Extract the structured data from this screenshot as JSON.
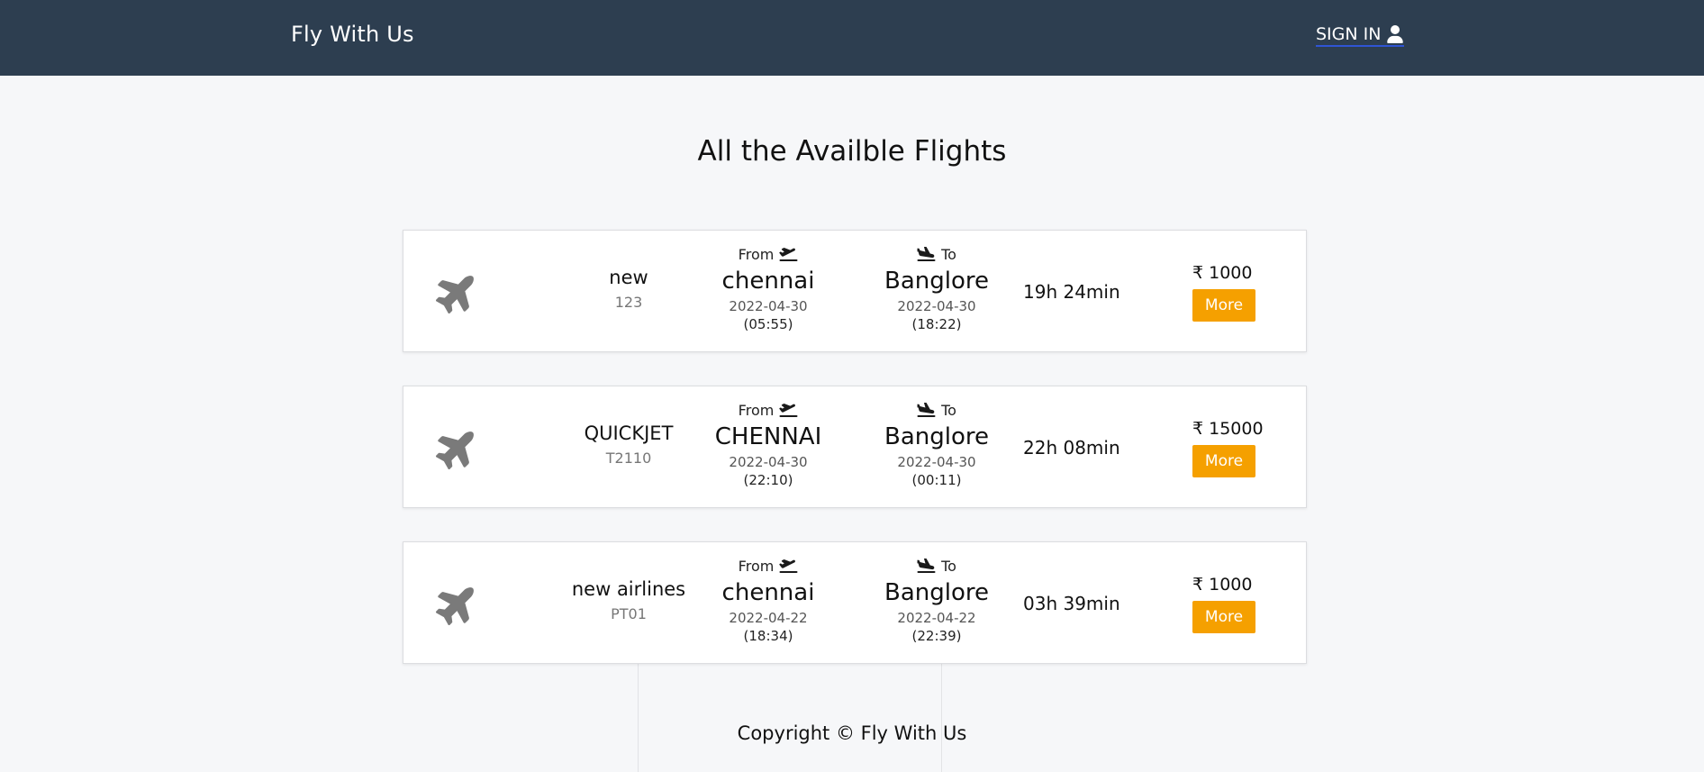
{
  "header": {
    "brand": "Fly With Us",
    "signin_label": "SIGN IN",
    "signin_icon": "user-icon",
    "background": "#2d3e50"
  },
  "main": {
    "title": "All the Availble Flights",
    "flights": [
      {
        "airline": "new",
        "code": "123",
        "from_label": "From",
        "from_city": "chennai",
        "from_date": "2022-04-30",
        "from_time": "(05:55)",
        "to_label": "To",
        "to_city": "Banglore",
        "to_date": "2022-04-30",
        "to_time": "(18:22)",
        "duration": "19h 24min",
        "price": "₹ 1000",
        "more_label": "More"
      },
      {
        "airline": "QUICKJET",
        "code": "T2110",
        "from_label": "From",
        "from_city": "CHENNAI",
        "from_date": "2022-04-30",
        "from_time": "(22:10)",
        "to_label": "To",
        "to_city": "Banglore",
        "to_date": "2022-04-30",
        "to_time": "(00:11)",
        "duration": "22h 08min",
        "price": "₹ 15000",
        "more_label": "More"
      },
      {
        "airline": "new airlines",
        "code": "PT01",
        "from_label": "From",
        "from_city": "chennai",
        "from_date": "2022-04-22",
        "from_time": "(18:34)",
        "to_label": "To",
        "to_city": "Banglore",
        "to_date": "2022-04-22",
        "to_time": "(22:39)",
        "duration": "03h 39min",
        "price": "₹ 1000",
        "more_label": "More"
      }
    ],
    "accent_color": "#f5a000"
  },
  "footer": {
    "copyright": "Copyright © Fly With Us"
  }
}
